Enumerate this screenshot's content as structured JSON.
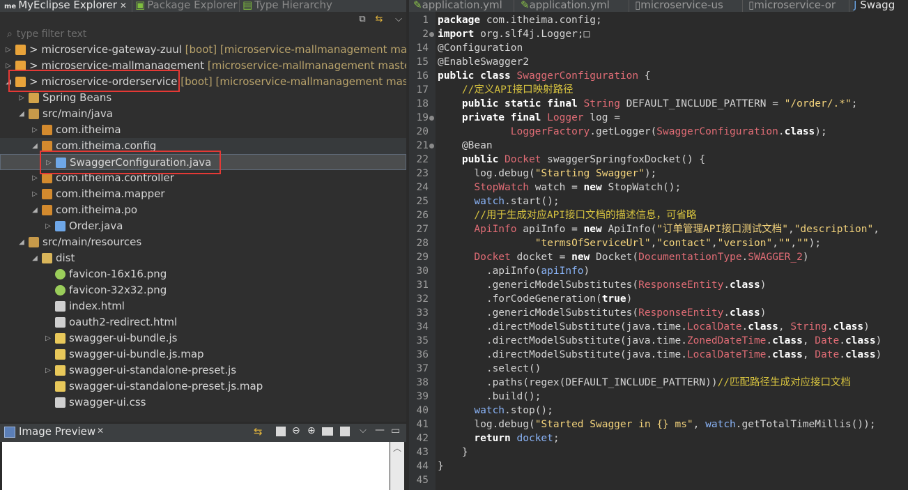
{
  "explorer": {
    "tabs": [
      {
        "label": "MyEclipse Explorer",
        "active": true,
        "badge": "me"
      },
      {
        "label": "Package Explorer",
        "active": false
      },
      {
        "label": "Type Hierarchy",
        "active": false
      }
    ],
    "filter_placeholder": "type filter text",
    "tree": [
      {
        "label": "> microservice-gateway-zuul",
        "decoration": " [boot] [microservice-mallmanagement mast",
        "indent": 0,
        "expanded": false,
        "icon": "boot-project-icon"
      },
      {
        "label": "> microservice-mallmanagement",
        "decoration": " [microservice-mallmanagement master]",
        "indent": 0,
        "expanded": false,
        "icon": "project-icon"
      },
      {
        "label": "> microservice-orderservice",
        "decoration": " [boot] [microservice-mallmanagement mast",
        "indent": 0,
        "expanded": true,
        "icon": "boot-project-icon"
      },
      {
        "label": "Spring Beans",
        "decoration": "",
        "indent": 1,
        "expanded": false,
        "icon": "spring-beans-icon"
      },
      {
        "label": "src/main/java",
        "decoration": "",
        "indent": 1,
        "expanded": true,
        "icon": "source-folder-icon"
      },
      {
        "label": "com.itheima",
        "decoration": "",
        "indent": 2,
        "expanded": false,
        "icon": "package-icon"
      },
      {
        "label": "com.itheima.config",
        "decoration": "",
        "indent": 2,
        "expanded": true,
        "icon": "package-icon"
      },
      {
        "label": "SwaggerConfiguration.java",
        "decoration": "",
        "indent": 3,
        "expanded": false,
        "icon": "java-file-icon"
      },
      {
        "label": "com.itheima.controller",
        "decoration": "",
        "indent": 2,
        "expanded": false,
        "icon": "package-icon"
      },
      {
        "label": "com.itheima.mapper",
        "decoration": "",
        "indent": 2,
        "expanded": false,
        "icon": "package-icon"
      },
      {
        "label": "com.itheima.po",
        "decoration": "",
        "indent": 2,
        "expanded": true,
        "icon": "package-icon"
      },
      {
        "label": "Order.java",
        "decoration": "",
        "indent": 3,
        "expanded": false,
        "icon": "java-file-icon"
      },
      {
        "label": "src/main/resources",
        "decoration": "",
        "indent": 1,
        "expanded": true,
        "icon": "resource-folder-icon"
      },
      {
        "label": "dist",
        "decoration": "",
        "indent": 2,
        "expanded": true,
        "icon": "folder-icon"
      },
      {
        "label": "favicon-16x16.png",
        "decoration": "",
        "indent": 3,
        "expanded": null,
        "icon": "image-file-icon"
      },
      {
        "label": "favicon-32x32.png",
        "decoration": "",
        "indent": 3,
        "expanded": null,
        "icon": "image-file-icon"
      },
      {
        "label": "index.html",
        "decoration": "",
        "indent": 3,
        "expanded": null,
        "icon": "html-file-icon"
      },
      {
        "label": "oauth2-redirect.html",
        "decoration": "",
        "indent": 3,
        "expanded": null,
        "icon": "html-file-icon"
      },
      {
        "label": "swagger-ui-bundle.js",
        "decoration": "",
        "indent": 3,
        "expanded": false,
        "icon": "js-file-icon"
      },
      {
        "label": "swagger-ui-bundle.js.map",
        "decoration": "",
        "indent": 3,
        "expanded": null,
        "icon": "map-file-icon"
      },
      {
        "label": "swagger-ui-standalone-preset.js",
        "decoration": "",
        "indent": 3,
        "expanded": false,
        "icon": "js-file-icon"
      },
      {
        "label": "swagger-ui-standalone-preset.js.map",
        "decoration": "",
        "indent": 3,
        "expanded": null,
        "icon": "map-file-icon"
      },
      {
        "label": "swagger-ui.css",
        "decoration": "",
        "indent": 3,
        "expanded": null,
        "icon": "css-file-icon"
      }
    ]
  },
  "preview": {
    "title": "Image Preview"
  },
  "editor": {
    "tabs": [
      {
        "label": "application.yml"
      },
      {
        "label": "application.yml"
      },
      {
        "label": "microservice-us"
      },
      {
        "label": "microservice-or"
      },
      {
        "label": "Swagg",
        "active": true
      }
    ],
    "lines": [
      {
        "n": "1",
        "fold": false,
        "parts": [
          [
            "k",
            "package"
          ],
          [
            "p",
            " com.itheima.config;"
          ]
        ]
      },
      {
        "n": "2",
        "fold": true,
        "parts": [
          [
            "k",
            "import"
          ],
          [
            "p",
            " org.slf4j.Logger;"
          ],
          [
            "p",
            "□"
          ]
        ]
      },
      {
        "n": "14",
        "fold": false,
        "parts": [
          [
            "p",
            "@Configuration"
          ]
        ]
      },
      {
        "n": "15",
        "fold": false,
        "parts": [
          [
            "p",
            "@EnableSwagger2"
          ]
        ]
      },
      {
        "n": "16",
        "fold": false,
        "parts": [
          [
            "k",
            "public"
          ],
          [
            "p",
            " "
          ],
          [
            "k",
            "class"
          ],
          [
            "p",
            " "
          ],
          [
            "ty",
            "SwaggerConfiguration"
          ],
          [
            "p",
            " {"
          ]
        ]
      },
      {
        "n": "17",
        "fold": false,
        "parts": [
          [
            "p",
            "    "
          ],
          [
            "cm",
            "//定义API接口映射路径"
          ]
        ]
      },
      {
        "n": "18",
        "fold": false,
        "parts": [
          [
            "p",
            "    "
          ],
          [
            "k",
            "public"
          ],
          [
            "p",
            " "
          ],
          [
            "k",
            "static"
          ],
          [
            "p",
            " "
          ],
          [
            "k",
            "final"
          ],
          [
            "p",
            " "
          ],
          [
            "ty",
            "String"
          ],
          [
            "p",
            " DEFAULT_INCLUDE_PATTERN = "
          ],
          [
            "st",
            "\"/order/.*\""
          ],
          [
            "p",
            ";"
          ]
        ]
      },
      {
        "n": "19",
        "fold": true,
        "parts": [
          [
            "p",
            "    "
          ],
          [
            "k",
            "private"
          ],
          [
            "p",
            " "
          ],
          [
            "k",
            "final"
          ],
          [
            "p",
            " "
          ],
          [
            "ty",
            "Logger"
          ],
          [
            "p",
            " log ="
          ]
        ]
      },
      {
        "n": "20",
        "fold": false,
        "parts": [
          [
            "p",
            "            "
          ],
          [
            "ty",
            "LoggerFactory"
          ],
          [
            "p",
            ".getLogger("
          ],
          [
            "ty",
            "SwaggerConfiguration"
          ],
          [
            "p",
            "."
          ],
          [
            "k",
            "class"
          ],
          [
            "p",
            ");"
          ]
        ]
      },
      {
        "n": "21",
        "fold": true,
        "parts": [
          [
            "p",
            "    @Bean"
          ]
        ]
      },
      {
        "n": "22",
        "fold": false,
        "parts": [
          [
            "p",
            "    "
          ],
          [
            "k",
            "public"
          ],
          [
            "p",
            " "
          ],
          [
            "ty",
            "Docket"
          ],
          [
            "p",
            " swaggerSpringfoxDocket() {"
          ]
        ]
      },
      {
        "n": "23",
        "fold": false,
        "parts": [
          [
            "p",
            "      log.debug("
          ],
          [
            "st",
            "\"Starting Swagger\""
          ],
          [
            "p",
            ");"
          ]
        ]
      },
      {
        "n": "24",
        "fold": false,
        "parts": [
          [
            "p",
            "      "
          ],
          [
            "ty",
            "StopWatch"
          ],
          [
            "p",
            " watch = "
          ],
          [
            "k",
            "new"
          ],
          [
            "p",
            " StopWatch();"
          ]
        ]
      },
      {
        "n": "25",
        "fold": false,
        "parts": [
          [
            "p",
            "      "
          ],
          [
            "fld",
            "watch"
          ],
          [
            "p",
            ".start();"
          ]
        ]
      },
      {
        "n": "26",
        "fold": false,
        "parts": [
          [
            "p",
            "      "
          ],
          [
            "cm",
            "//用于生成对应API接口文档的描述信息，可省略"
          ]
        ]
      },
      {
        "n": "27",
        "fold": false,
        "parts": [
          [
            "p",
            "      "
          ],
          [
            "ty",
            "ApiInfo"
          ],
          [
            "p",
            " apiInfo = "
          ],
          [
            "k",
            "new"
          ],
          [
            "p",
            " ApiInfo("
          ],
          [
            "st",
            "\"订单管理API接口测试文档\""
          ],
          [
            "p",
            ","
          ],
          [
            "st",
            "\"description\""
          ],
          [
            "p",
            ","
          ]
        ]
      },
      {
        "n": "28",
        "fold": false,
        "parts": [
          [
            "p",
            "                "
          ],
          [
            "st",
            "\"termsOfServiceUrl\""
          ],
          [
            "p",
            ","
          ],
          [
            "st",
            "\"contact\""
          ],
          [
            "p",
            ","
          ],
          [
            "st",
            "\"version\""
          ],
          [
            "p",
            ","
          ],
          [
            "st",
            "\"\""
          ],
          [
            "p",
            ","
          ],
          [
            "st",
            "\"\""
          ],
          [
            "p",
            ");"
          ]
        ]
      },
      {
        "n": "29",
        "fold": false,
        "parts": [
          [
            "p",
            "      "
          ],
          [
            "ty",
            "Docket"
          ],
          [
            "p",
            " docket = "
          ],
          [
            "k",
            "new"
          ],
          [
            "p",
            " Docket("
          ],
          [
            "ty",
            "DocumentationType"
          ],
          [
            "p",
            "."
          ],
          [
            "cst",
            "SWAGGER_2"
          ],
          [
            "p",
            ")"
          ]
        ]
      },
      {
        "n": "30",
        "fold": false,
        "parts": [
          [
            "p",
            "        .apiInfo("
          ],
          [
            "fld",
            "apiInfo"
          ],
          [
            "p",
            ")"
          ]
        ]
      },
      {
        "n": "31",
        "fold": false,
        "parts": [
          [
            "p",
            "        .genericModelSubstitutes("
          ],
          [
            "ty",
            "ResponseEntity"
          ],
          [
            "p",
            "."
          ],
          [
            "k",
            "class"
          ],
          [
            "p",
            ")"
          ]
        ]
      },
      {
        "n": "32",
        "fold": false,
        "parts": [
          [
            "p",
            "        .forCodeGeneration("
          ],
          [
            "k",
            "true"
          ],
          [
            "p",
            ")"
          ]
        ]
      },
      {
        "n": "33",
        "fold": false,
        "parts": [
          [
            "p",
            "        .genericModelSubstitutes("
          ],
          [
            "ty",
            "ResponseEntity"
          ],
          [
            "p",
            "."
          ],
          [
            "k",
            "class"
          ],
          [
            "p",
            ")"
          ]
        ]
      },
      {
        "n": "34",
        "fold": false,
        "parts": [
          [
            "p",
            "        .directModelSubstitute(java.time."
          ],
          [
            "ty",
            "LocalDate"
          ],
          [
            "p",
            "."
          ],
          [
            "k",
            "class"
          ],
          [
            "p",
            ", "
          ],
          [
            "ty",
            "String"
          ],
          [
            "p",
            "."
          ],
          [
            "k",
            "class"
          ],
          [
            "p",
            ")"
          ]
        ]
      },
      {
        "n": "35",
        "fold": false,
        "parts": [
          [
            "p",
            "        .directModelSubstitute(java.time."
          ],
          [
            "ty",
            "ZonedDateTime"
          ],
          [
            "p",
            "."
          ],
          [
            "k",
            "class"
          ],
          [
            "p",
            ", "
          ],
          [
            "ty",
            "Date"
          ],
          [
            "p",
            "."
          ],
          [
            "k",
            "class"
          ],
          [
            "p",
            ")"
          ]
        ]
      },
      {
        "n": "36",
        "fold": false,
        "parts": [
          [
            "p",
            "        .directModelSubstitute(java.time."
          ],
          [
            "ty",
            "LocalDateTime"
          ],
          [
            "p",
            "."
          ],
          [
            "k",
            "class"
          ],
          [
            "p",
            ", "
          ],
          [
            "ty",
            "Date"
          ],
          [
            "p",
            "."
          ],
          [
            "k",
            "class"
          ],
          [
            "p",
            ")"
          ]
        ]
      },
      {
        "n": "37",
        "fold": false,
        "parts": [
          [
            "p",
            "        .select()"
          ]
        ]
      },
      {
        "n": "38",
        "fold": false,
        "parts": [
          [
            "p",
            "        .paths(regex(DEFAULT_INCLUDE_PATTERN))"
          ],
          [
            "cm",
            "//匹配路径生成对应接口文档"
          ]
        ]
      },
      {
        "n": "39",
        "fold": false,
        "parts": [
          [
            "p",
            "        .build();"
          ]
        ]
      },
      {
        "n": "40",
        "fold": false,
        "parts": [
          [
            "p",
            "      "
          ],
          [
            "fld",
            "watch"
          ],
          [
            "p",
            ".stop();"
          ]
        ]
      },
      {
        "n": "41",
        "fold": false,
        "parts": [
          [
            "p",
            "      log.debug("
          ],
          [
            "st",
            "\"Started Swagger in {} ms\""
          ],
          [
            "p",
            ", "
          ],
          [
            "fld",
            "watch"
          ],
          [
            "p",
            ".getTotalTimeMillis());"
          ]
        ]
      },
      {
        "n": "42",
        "fold": false,
        "parts": [
          [
            "p",
            "      "
          ],
          [
            "k",
            "return"
          ],
          [
            "p",
            " "
          ],
          [
            "fld",
            "docket"
          ],
          [
            "p",
            ";"
          ]
        ]
      },
      {
        "n": "43",
        "fold": false,
        "parts": [
          [
            "p",
            "    }"
          ]
        ]
      },
      {
        "n": "44",
        "fold": false,
        "parts": [
          [
            "p",
            "}"
          ]
        ]
      },
      {
        "n": "45",
        "fold": false,
        "parts": [
          [
            "p",
            ""
          ]
        ]
      }
    ]
  },
  "colors": {
    "highlight_box": "#e53935",
    "comment": "#d7c33f",
    "string": "#f2d27b",
    "type": "#e06c75"
  }
}
